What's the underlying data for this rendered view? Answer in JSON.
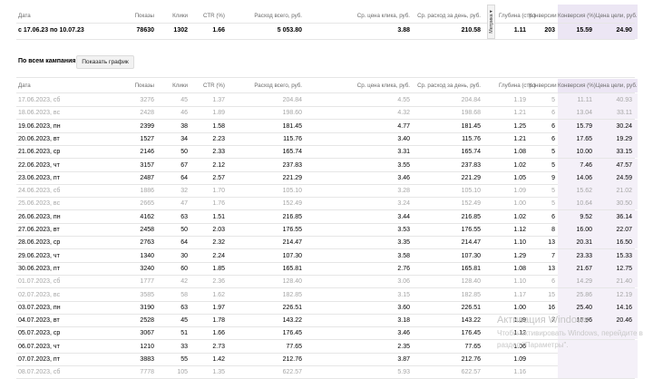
{
  "columns": [
    "Дата",
    "Показы",
    "Клики",
    "CTR (%)",
    "Расход всего, руб.",
    "Ср. цена клика, руб.",
    "Ср. расход за день, руб.",
    "Глубина (стр.)",
    "Конверсии",
    "Конверсия (%)",
    "Цена цели, руб."
  ],
  "metrika_tab": "Метрика ▾",
  "summary": [
    "с 17.06.23 по 10.07.23",
    "78630",
    "1302",
    "1.66",
    "5 053.80",
    "3.88",
    "210.58",
    "1.11",
    "203",
    "15.59",
    "24.90"
  ],
  "section_title": "По всем кампаниям",
  "chart_button_label": "Показать график",
  "rows": [
    {
      "dim": true,
      "cells": [
        "17.06.2023, сб",
        "3276",
        "45",
        "1.37",
        "204.84",
        "4.55",
        "204.84",
        "1.19",
        "5",
        "11.11",
        "40.93"
      ]
    },
    {
      "dim": true,
      "cells": [
        "18.06.2023, вс",
        "2428",
        "46",
        "1.89",
        "198.60",
        "4.32",
        "198.68",
        "1.21",
        "6",
        "13.04",
        "33.11"
      ]
    },
    {
      "dim": false,
      "cells": [
        "19.06.2023, пн",
        "2399",
        "38",
        "1.58",
        "181.45",
        "4.77",
        "181.45",
        "1.25",
        "6",
        "15.79",
        "30.24"
      ]
    },
    {
      "dim": false,
      "cells": [
        "20.06.2023, вт",
        "1527",
        "34",
        "2.23",
        "115.76",
        "3.40",
        "115.76",
        "1.21",
        "6",
        "17.65",
        "19.29"
      ]
    },
    {
      "dim": false,
      "cells": [
        "21.06.2023, ср",
        "2146",
        "50",
        "2.33",
        "165.74",
        "3.31",
        "165.74",
        "1.08",
        "5",
        "10.00",
        "33.15"
      ]
    },
    {
      "dim": false,
      "cells": [
        "22.06.2023, чт",
        "3157",
        "67",
        "2.12",
        "237.83",
        "3.55",
        "237.83",
        "1.02",
        "5",
        "7.46",
        "47.57"
      ]
    },
    {
      "dim": false,
      "cells": [
        "23.06.2023, пт",
        "2487",
        "64",
        "2.57",
        "221.29",
        "3.46",
        "221.29",
        "1.05",
        "9",
        "14.06",
        "24.59"
      ]
    },
    {
      "dim": true,
      "cells": [
        "24.06.2023, сб",
        "1886",
        "32",
        "1.70",
        "105.10",
        "3.28",
        "105.10",
        "1.09",
        "5",
        "15.62",
        "21.02"
      ]
    },
    {
      "dim": true,
      "cells": [
        "25.06.2023, вс",
        "2665",
        "47",
        "1.76",
        "152.49",
        "3.24",
        "152.49",
        "1.00",
        "5",
        "10.64",
        "30.50"
      ]
    },
    {
      "dim": false,
      "cells": [
        "26.06.2023, пн",
        "4162",
        "63",
        "1.51",
        "216.85",
        "3.44",
        "216.85",
        "1.02",
        "6",
        "9.52",
        "36.14"
      ]
    },
    {
      "dim": false,
      "cells": [
        "27.06.2023, вт",
        "2458",
        "50",
        "2.03",
        "176.55",
        "3.53",
        "176.55",
        "1.12",
        "8",
        "16.00",
        "22.07"
      ]
    },
    {
      "dim": false,
      "cells": [
        "28.06.2023, ср",
        "2763",
        "64",
        "2.32",
        "214.47",
        "3.35",
        "214.47",
        "1.10",
        "13",
        "20.31",
        "16.50"
      ]
    },
    {
      "dim": false,
      "cells": [
        "29.06.2023, чт",
        "1340",
        "30",
        "2.24",
        "107.30",
        "3.58",
        "107.30",
        "1.29",
        "7",
        "23.33",
        "15.33"
      ]
    },
    {
      "dim": false,
      "cells": [
        "30.06.2023, пт",
        "3240",
        "60",
        "1.85",
        "165.81",
        "2.76",
        "165.81",
        "1.08",
        "13",
        "21.67",
        "12.75"
      ]
    },
    {
      "dim": true,
      "cells": [
        "01.07.2023, сб",
        "1777",
        "42",
        "2.36",
        "128.40",
        "3.06",
        "128.40",
        "1.10",
        "6",
        "14.29",
        "21.40"
      ]
    },
    {
      "dim": true,
      "cells": [
        "02.07.2023, вс",
        "3585",
        "58",
        "1.62",
        "182.85",
        "3.15",
        "182.85",
        "1.17",
        "15",
        "25.86",
        "12.19"
      ]
    },
    {
      "dim": false,
      "cells": [
        "03.07.2023, пн",
        "3190",
        "63",
        "1.97",
        "226.51",
        "3.60",
        "226.51",
        "1.00",
        "16",
        "25.40",
        "14.16"
      ]
    },
    {
      "dim": false,
      "cells": [
        "04.07.2023, вт",
        "2528",
        "45",
        "1.78",
        "143.22",
        "3.18",
        "143.22",
        "1.09",
        "7",
        "15.56",
        "20.46"
      ]
    },
    {
      "dim": false,
      "cells": [
        "05.07.2023, ср",
        "3067",
        "51",
        "1.66",
        "176.45",
        "3.46",
        "176.45",
        "1.12",
        "",
        "",
        ""
      ]
    },
    {
      "dim": false,
      "cells": [
        "06.07.2023, чт",
        "1210",
        "33",
        "2.73",
        "77.65",
        "2.35",
        "77.65",
        "1.06",
        "",
        "",
        ""
      ]
    },
    {
      "dim": false,
      "cells": [
        "07.07.2023, пт",
        "3883",
        "55",
        "1.42",
        "212.76",
        "3.87",
        "212.76",
        "1.09",
        "",
        "",
        ""
      ]
    },
    {
      "dim": true,
      "cells": [
        "08.07.2023, сб",
        "7778",
        "105",
        "1.35",
        "622.57",
        "5.93",
        "622.57",
        "1.16",
        "",
        "",
        ""
      ]
    }
  ],
  "watermark": {
    "line1": "Активация Windows",
    "line2": "Чтобы активировать Windows, перейдите в",
    "line3": "раздел \"Параметры\"."
  }
}
